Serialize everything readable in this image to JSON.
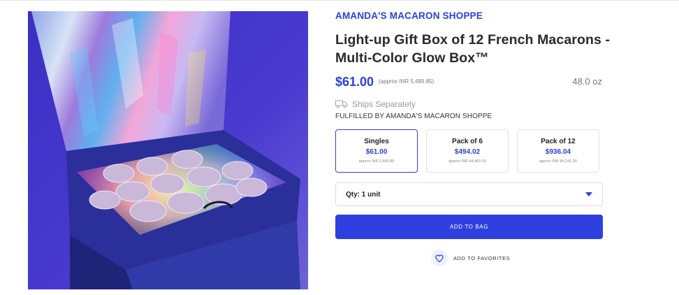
{
  "product": {
    "vendor": "AMANDA'S MACARON SHOPPE",
    "title": "Light-up Gift Box of 12 French Macarons - Multi-Color Glow Box™",
    "price": "$61.00",
    "approx_price": "(approx INR 5,489.85)",
    "weight": "48.0 oz",
    "ships_note": "Ships Separately",
    "fulfilled_by": "FULFILLED BY AMANDA'S MACARON SHOPPE"
  },
  "variants": [
    {
      "name": "Singles",
      "price": "$61.00",
      "approx": "approx INR 5,489.85",
      "selected": true
    },
    {
      "name": "Pack of 6",
      "price": "$494.02",
      "approx": "approx INR 44,460.59",
      "selected": false
    },
    {
      "name": "Pack of 12",
      "price": "$936.04",
      "approx": "approx INR 84,241.30",
      "selected": false
    }
  ],
  "quantity": {
    "label": "Qty: 1 unit"
  },
  "actions": {
    "add_to_bag": "ADD TO BAG",
    "add_to_favorites": "ADD TO FAVORITES"
  },
  "icons": {
    "zoom": "magnifier-icon",
    "ships": "truck-icon",
    "dropdown": "caret-down-icon",
    "favorite": "heart-icon"
  },
  "colors": {
    "accent": "#2c3fd8",
    "button": "#2d40df",
    "text": "#2a2a2a"
  }
}
